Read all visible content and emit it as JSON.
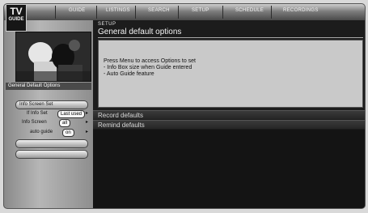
{
  "header": {
    "logo_line1": "TV",
    "logo_line2": "GUIDE",
    "tabs": [
      {
        "label": "GUIDE"
      },
      {
        "label": "LISTINGS"
      },
      {
        "label": "SEARCH"
      },
      {
        "label": "SETUP"
      },
      {
        "label": "SCHEDULE"
      },
      {
        "label": "RECORDINGS"
      }
    ]
  },
  "sidebar": {
    "title": "General Default Options",
    "items": [
      {
        "label": "Info Screen Set"
      },
      {
        "label": ""
      },
      {
        "label": ""
      }
    ],
    "options": [
      {
        "label": "If Info Set",
        "value": "Last used"
      },
      {
        "label": "Info Screen",
        "value": "all"
      },
      {
        "label": "auto guide",
        "value": "on"
      }
    ]
  },
  "main": {
    "breadcrumb": "SETUP",
    "title": "General default options",
    "info_lines": [
      "Press Menu to access Options to set",
      "- Info Box size when Guide entered",
      "- Auto Guide feature"
    ],
    "sections": [
      {
        "label": "Record defaults"
      },
      {
        "label": "Remind defaults"
      }
    ]
  }
}
